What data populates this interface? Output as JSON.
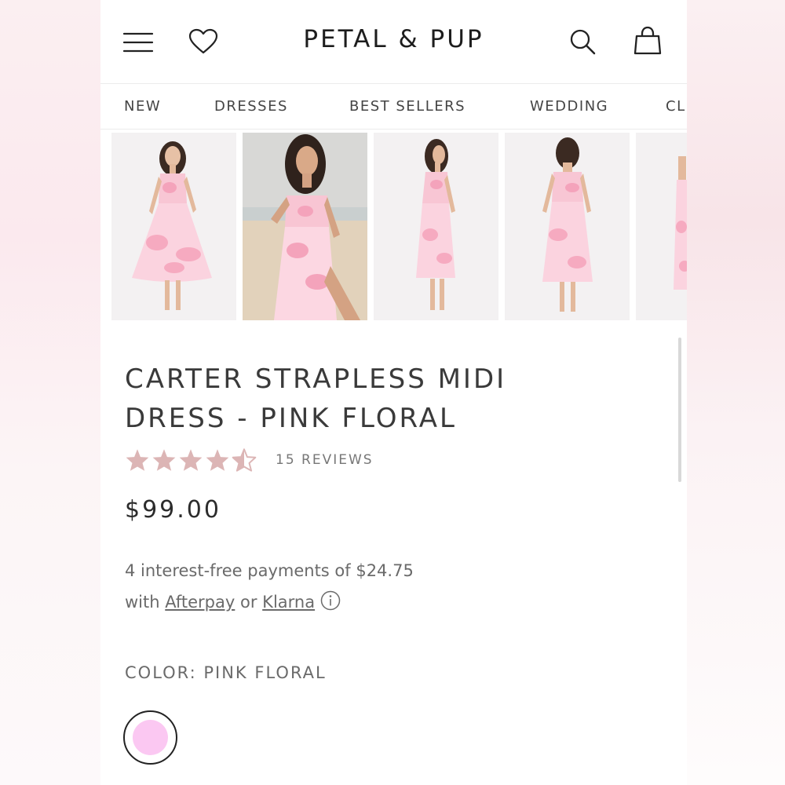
{
  "header": {
    "logo": "PETAL & PUP",
    "menu_icon": "hamburger-menu-icon",
    "wishlist_icon": "heart-icon",
    "search_icon": "search-icon",
    "cart_icon": "shopping-bag-icon"
  },
  "nav": {
    "items": [
      "NEW",
      "DRESSES",
      "BEST SELLERS",
      "WEDDING",
      "CL"
    ]
  },
  "gallery": {
    "images": [
      "product-image-front-studio",
      "product-image-beach",
      "product-image-side-studio",
      "product-image-back-studio",
      "product-image-partial"
    ]
  },
  "product": {
    "title_line1": "CARTER STRAPLESS MIDI",
    "title_line2": "DRESS - PINK FLORAL",
    "rating": 4.5,
    "rating_max": 5,
    "reviews_label": "15 REVIEWS",
    "price": "$99.00",
    "installment_line1": "4 interest-free payments of $24.75",
    "installment_with": "with",
    "installment_afterpay": "Afterpay",
    "installment_or": "or",
    "installment_klarna": "Klarna",
    "color_label": "COLOR: PINK FLORAL",
    "swatch_color": "#fbc8f2"
  },
  "colors": {
    "star": "#dcb5b5",
    "text_dark": "#1d1d1d",
    "text_muted": "#6a6a6a"
  }
}
